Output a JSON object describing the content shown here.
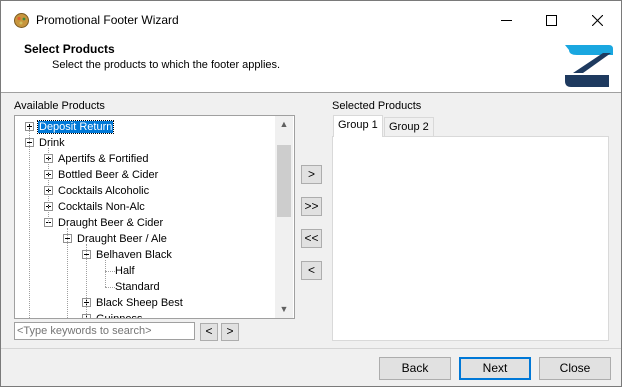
{
  "window": {
    "title": "Promotional Footer Wizard"
  },
  "header": {
    "title": "Select Products",
    "subtitle": "Select the products to which the footer applies."
  },
  "left": {
    "label": "Available Products",
    "search_placeholder": "<Type keywords to search>",
    "prev_label": "<",
    "next_label": ">"
  },
  "right": {
    "label": "Selected Products",
    "tabs": [
      "Group 1",
      "Group 2"
    ]
  },
  "tree": [
    {
      "label": "Deposit Return",
      "expander": "plus",
      "selected": true
    },
    {
      "label": "Drink",
      "expander": "minus"
    },
    {
      "label": "Apertifs & Fortified",
      "expander": "plus"
    },
    {
      "label": "Bottled Beer & Cider",
      "expander": "plus"
    },
    {
      "label": "Cocktails Alcoholic",
      "expander": "plus"
    },
    {
      "label": "Cocktails Non-Alc",
      "expander": "plus"
    },
    {
      "label": "Draught Beer & Cider",
      "expander": "minus"
    },
    {
      "label": "Draught Beer / Ale",
      "expander": "minus"
    },
    {
      "label": "Belhaven Black",
      "expander": "minus"
    },
    {
      "label": "Half",
      "expander": "none"
    },
    {
      "label": "Standard",
      "expander": "none"
    },
    {
      "label": "Black Sheep Best",
      "expander": "plus"
    },
    {
      "label": "Guinness",
      "expander": "plus"
    }
  ],
  "move_buttons": {
    "add": ">",
    "add_all": ">>",
    "remove_all": "<<",
    "remove": "<"
  },
  "footer": {
    "back": "Back",
    "next": "Next",
    "close": "Close"
  },
  "colors": {
    "selection": "#0078d7",
    "logo_blue": "#1aa7e0",
    "logo_dark": "#1e3a5f"
  }
}
